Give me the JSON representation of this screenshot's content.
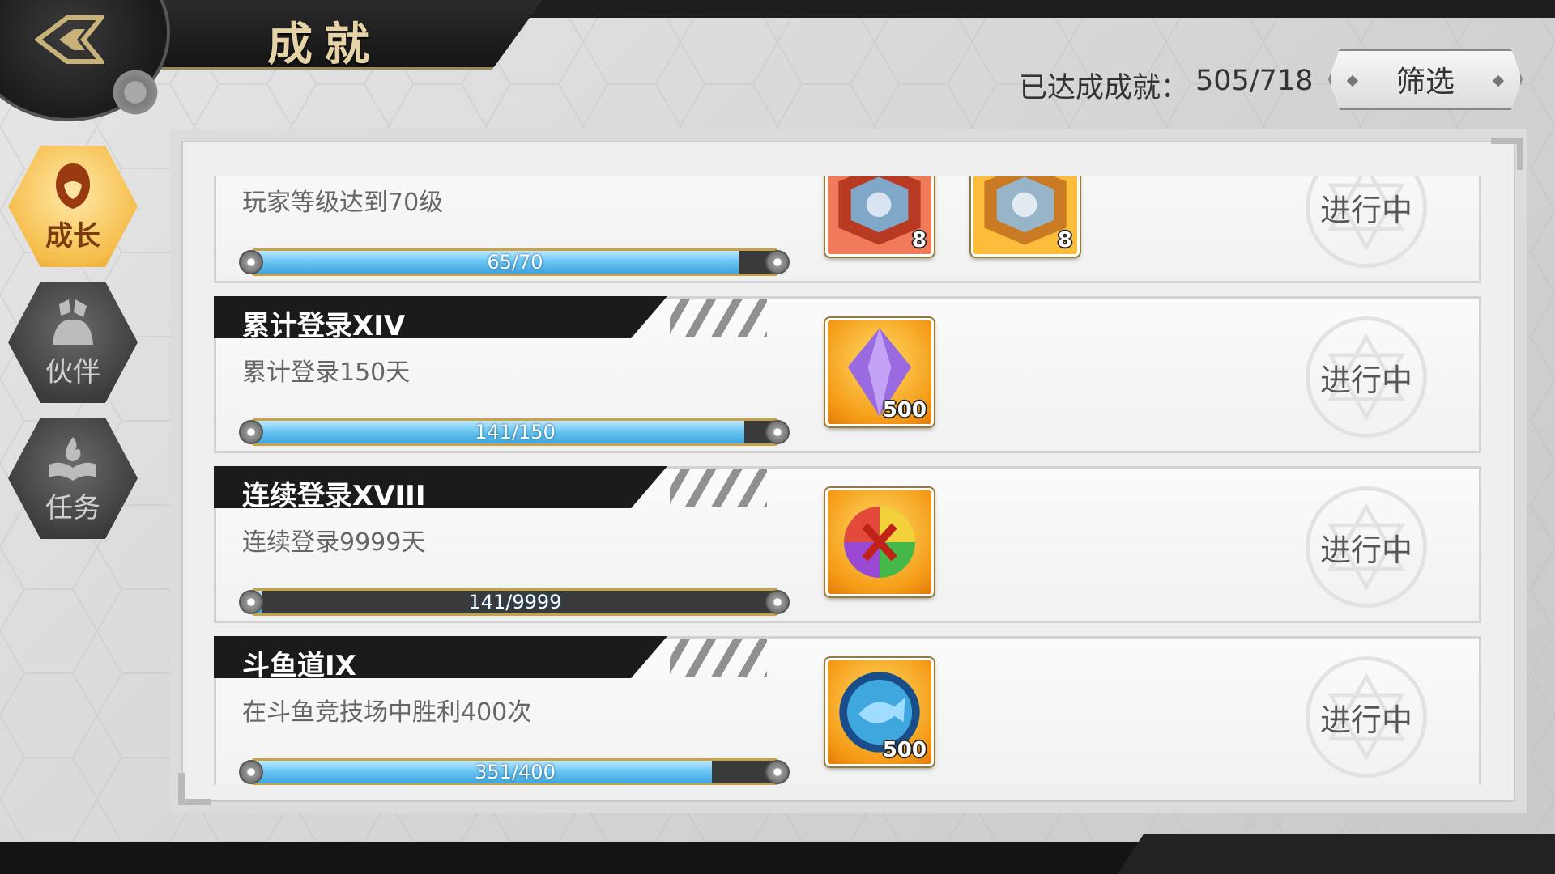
{
  "header": {
    "title": "成就",
    "achieved_label": "已达成成就：",
    "achieved_value": "505/718",
    "filter_label": "筛选"
  },
  "side_nav": [
    {
      "label": "成长",
      "icon": "growth-icon",
      "active": true
    },
    {
      "label": "伙伴",
      "icon": "partner-icon",
      "active": false
    },
    {
      "label": "任务",
      "icon": "quest-icon",
      "active": false
    }
  ],
  "achievements": [
    {
      "title": "",
      "desc": "玩家等级达到70级",
      "progress_text": "65/70",
      "progress_fraction": 0.9286,
      "rewards": [
        {
          "icon": "red-chest-icon",
          "qty": "8"
        },
        {
          "icon": "gold-chest-icon",
          "qty": "8"
        }
      ],
      "status": "进行中"
    },
    {
      "title": "累计登录XIV",
      "desc": "累计登录150天",
      "progress_text": "141/150",
      "progress_fraction": 0.94,
      "rewards": [
        {
          "icon": "purple-crystal-icon",
          "qty": "500"
        }
      ],
      "status": "进行中"
    },
    {
      "title": "连续登录XVIII",
      "desc": "连续登录9999天",
      "progress_text": "141/9999",
      "progress_fraction": 0.0141,
      "rewards": [
        {
          "icon": "rainbow-x-coin-icon",
          "qty": ""
        }
      ],
      "status": "进行中"
    },
    {
      "title": "斗鱼道IX",
      "desc": "在斗鱼竞技场中胜利400次",
      "progress_text": "351/400",
      "progress_fraction": 0.8775,
      "rewards": [
        {
          "icon": "blue-fish-coin-icon",
          "qty": "500"
        }
      ],
      "status": "进行中"
    }
  ]
}
